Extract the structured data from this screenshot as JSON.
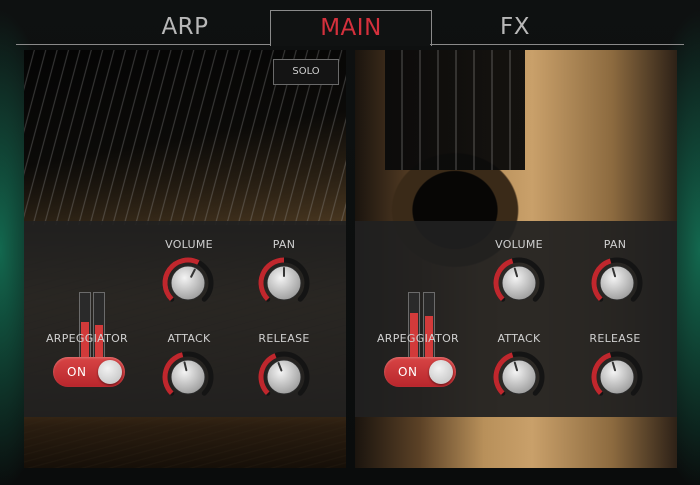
{
  "tabs": {
    "arp": "ARP",
    "main": "MAIN",
    "fx": "FX"
  },
  "solo_label": "SOLO",
  "left_panel": {
    "meters": [
      0.55,
      0.5
    ],
    "labels": {
      "volume": "VOLUME",
      "pan": "PAN",
      "arpeggiator": "ARPEGGIATOR",
      "attack": "ATTACK",
      "release": "RELEASE"
    },
    "arpeggiator_toggle": "ON",
    "knobs": {
      "volume": 0.6,
      "pan": 0.5,
      "attack": 0.45,
      "release": 0.42
    }
  },
  "right_panel": {
    "meters": [
      0.68,
      0.63
    ],
    "labels": {
      "volume": "VOLUME",
      "pan": "PAN",
      "arpeggiator": "ARPEGGIATOR",
      "attack": "ATTACK",
      "release": "RELEASE"
    },
    "arpeggiator_toggle": "ON",
    "knobs": {
      "volume": 0.44,
      "pan": 0.44,
      "attack": 0.44,
      "release": 0.44
    }
  },
  "colors": {
    "accent": "#d4303c",
    "meter": "#d23a3a",
    "knob_arc": "#c0272d"
  }
}
